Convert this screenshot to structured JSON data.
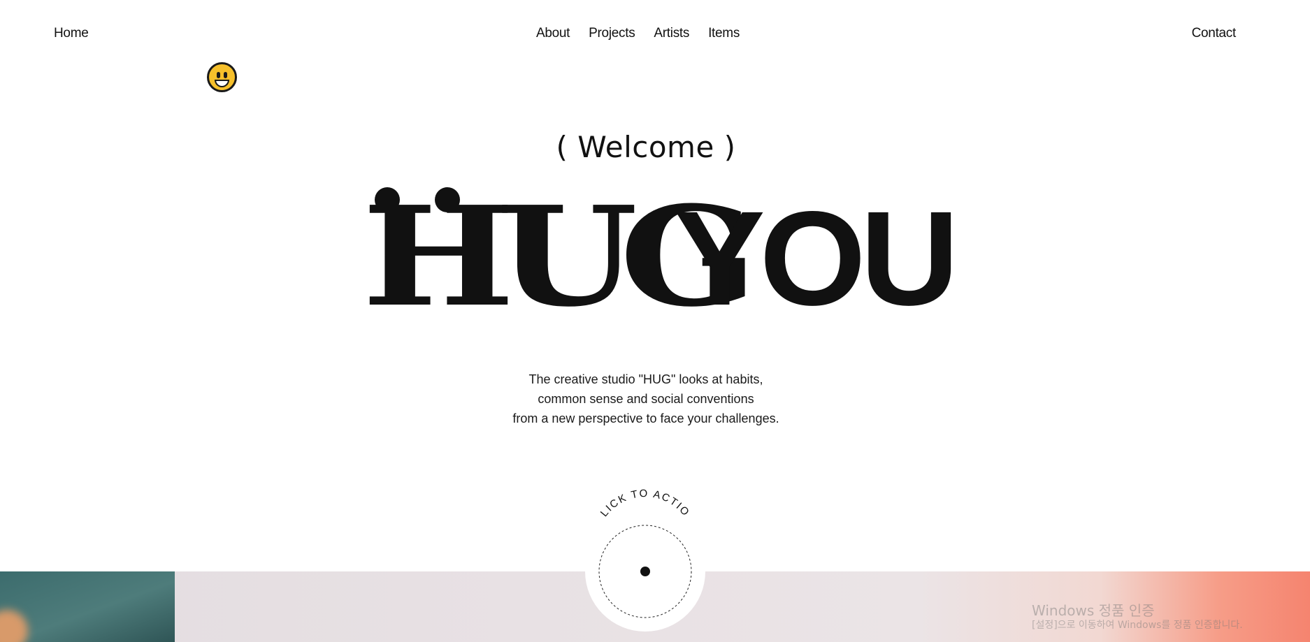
{
  "nav": {
    "home": "Home",
    "about": "About",
    "projects": "Projects",
    "artists": "Artists",
    "items": "Items",
    "contact": "Contact"
  },
  "hero": {
    "welcome": "( Welcome )",
    "headline_left": "HUG",
    "headline_right": "YOU",
    "description": [
      "The creative studio \"HUG\" looks at habits,",
      "common sense and social conventions",
      "from a new perspective to face your challenges."
    ]
  },
  "cta": {
    "label": "CLICK TO ACTION"
  },
  "watermark": {
    "title": "Windows 정품 인증",
    "subtitle": "[설정]으로 이동하여 Windows를 정품 인증합니다."
  },
  "colors": {
    "text": "#111111",
    "background": "#ffffff",
    "strip_teal": "#3c6c6d",
    "strip_pink": "#e8e1e4",
    "strip_coral": "#f5846f"
  },
  "icons": {
    "avatar": "grinning-face-emoji"
  }
}
